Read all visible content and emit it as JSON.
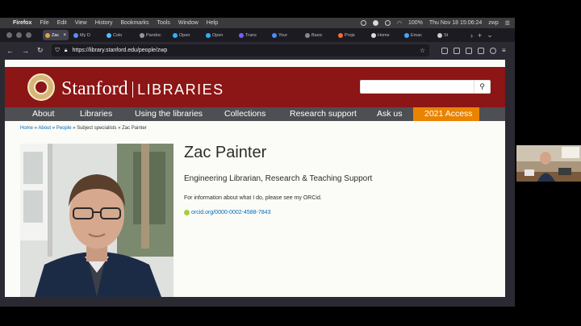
{
  "menubar": {
    "app_name": "Firefox",
    "menus": [
      "File",
      "Edit",
      "View",
      "History",
      "Bookmarks",
      "Tools",
      "Window",
      "Help"
    ],
    "battery": "100%",
    "datetime": "Thu Nov 18  15:06:24",
    "user": "zwp"
  },
  "tabs": [
    {
      "label": "Zac",
      "active": true,
      "color": "#e8a040"
    },
    {
      "label": "My D",
      "active": false,
      "color": "#5b8def"
    },
    {
      "label": "Colo",
      "active": false,
      "color": "#4cc2ff"
    },
    {
      "label": "Pandoc",
      "active": false,
      "color": "#999999"
    },
    {
      "label": "Open",
      "active": false,
      "color": "#2fb0ff"
    },
    {
      "label": "Open",
      "active": false,
      "color": "#2fb0ff"
    },
    {
      "label": "Trans",
      "active": false,
      "color": "#7a5cff"
    },
    {
      "label": "Your",
      "active": false,
      "color": "#4c8cff"
    },
    {
      "label": "Basic",
      "active": false,
      "color": "#888888"
    },
    {
      "label": "Proje",
      "active": false,
      "color": "#ff6a2a"
    },
    {
      "label": "Home",
      "active": false,
      "color": "#dddddd"
    },
    {
      "label": "Emac",
      "active": false,
      "color": "#4aa3ff"
    },
    {
      "label": "St",
      "active": false,
      "color": "#cccccc"
    }
  ],
  "tab_controls": {
    "scroll": "›",
    "new": "+",
    "list": "⌄"
  },
  "navbar": {
    "back": "←",
    "forward": "→",
    "reload": "↻",
    "url": "https://library.stanford.edu/people/zwp",
    "star": "☆"
  },
  "site": {
    "brand_main": "Stanford",
    "brand_sub": "LIBRARIES",
    "search_icon": "⚲",
    "nav": [
      "About",
      "Libraries",
      "Using the libraries",
      "Collections",
      "Research support",
      "Ask us"
    ],
    "nav_highlight": "2021 Access",
    "accent": "#8c1515",
    "highlight_color": "#e98300"
  },
  "breadcrumb": {
    "home": "Home",
    "about": "About",
    "people": "People",
    "sep": " » ",
    "rest": "Subject specialists » Zac Painter"
  },
  "person": {
    "name": "Zac Painter",
    "title": "Engineering Librarian, Research & Teaching Support",
    "info": "For information about what I do, please see my ORCid.",
    "orcid": "orcid.org/0000-0002-4588-7843"
  }
}
